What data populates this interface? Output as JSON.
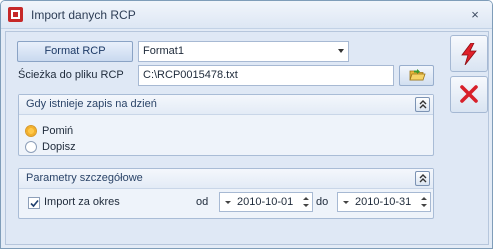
{
  "window": {
    "title": "Import danych RCP",
    "close_label": "×"
  },
  "top": {
    "format_button": "Format RCP",
    "format_value": "Format1",
    "path_label": "Ścieżka do pliku RCP",
    "path_value": "C:\\RCP0015478.txt"
  },
  "group_exists": {
    "title": "Gdy istnieje zapis na dzień",
    "options": [
      {
        "label": "Pomiń",
        "checked": true
      },
      {
        "label": "Dopisz",
        "checked": false
      }
    ]
  },
  "group_params": {
    "title": "Parametry szczegółowe",
    "import_label": "Import za okres",
    "import_checked": true,
    "od_label": "od",
    "date_from": "2010-10-01",
    "do_label": "do",
    "date_to": "2010-10-31"
  },
  "side_buttons": [
    {
      "icon": "lightning-icon",
      "color": "#e0202a"
    },
    {
      "icon": "cancel-x-icon",
      "color": "#d8202a"
    }
  ],
  "colors": {
    "accent_radio": "#f3b12d",
    "panel_border": "#a9bcd6"
  }
}
